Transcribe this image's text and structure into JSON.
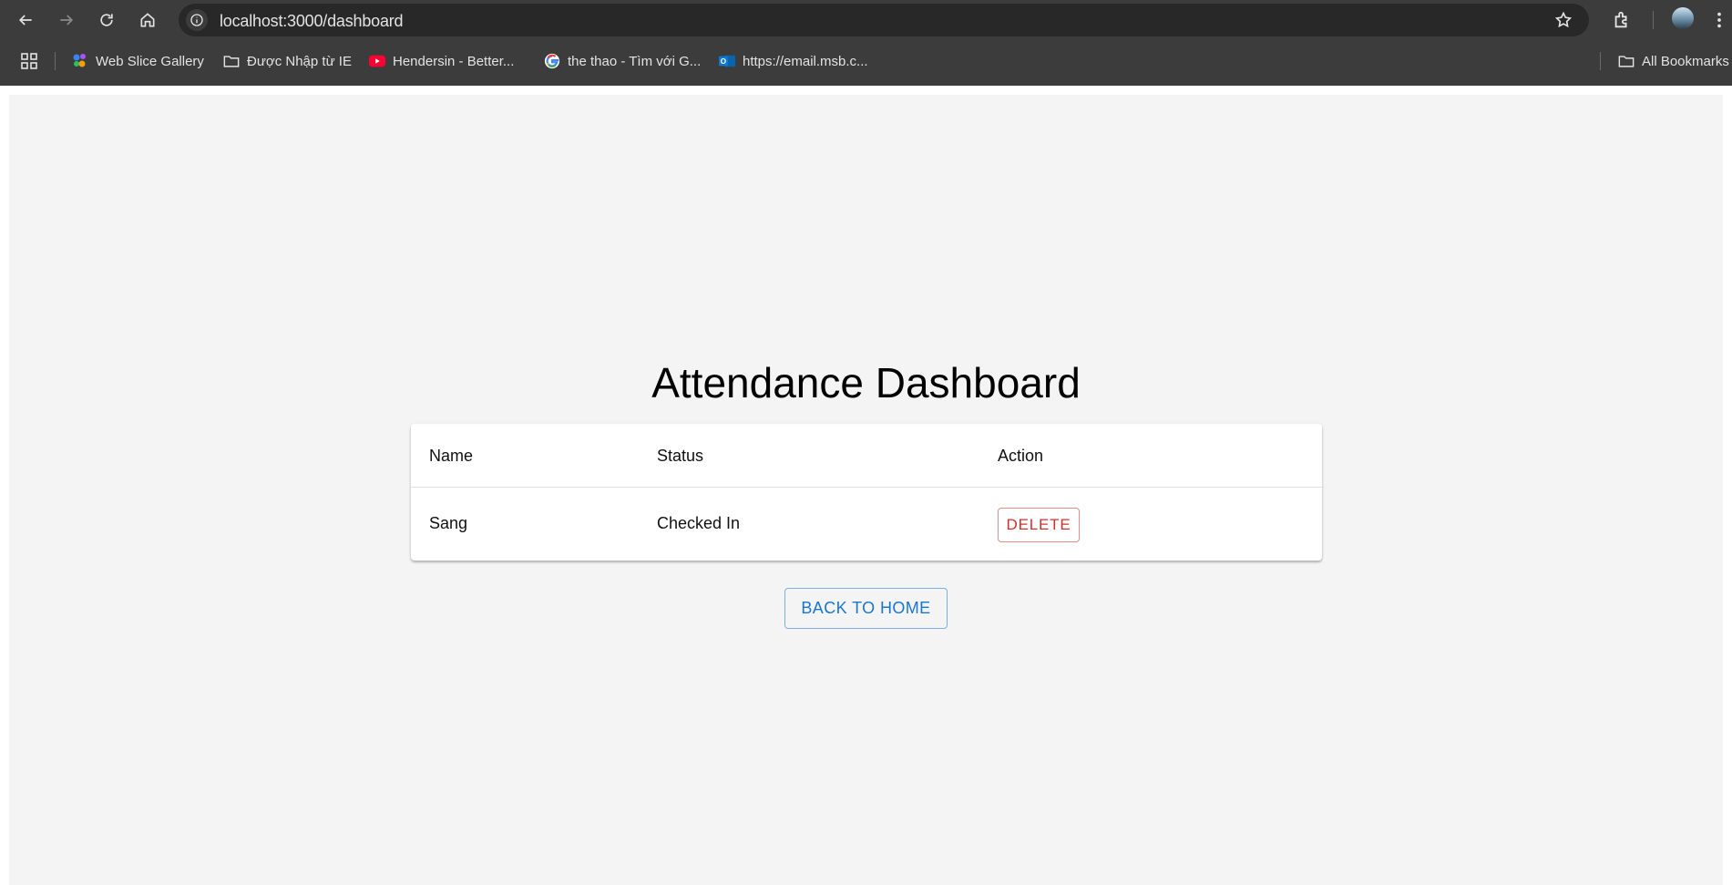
{
  "browser": {
    "url": "localhost:3000/dashboard",
    "bookmarks": [
      {
        "label": "Web Slice Gallery",
        "icon": "web-slice-icon"
      },
      {
        "label": "Được Nhập từ IE",
        "icon": "folder-icon"
      },
      {
        "label": "Hendersin - Better...",
        "icon": "youtube-icon"
      },
      {
        "label": "the thao - Tìm với G...",
        "icon": "google-icon"
      },
      {
        "label": "https://email.msb.c...",
        "icon": "outlook-icon"
      }
    ],
    "all_bookmarks_label": "All Bookmarks"
  },
  "page": {
    "title": "Attendance Dashboard",
    "table": {
      "headers": [
        "Name",
        "Status",
        "Action"
      ],
      "rows": [
        {
          "name": "Sang",
          "status": "Checked In",
          "action_label": "DELETE"
        }
      ]
    },
    "back_button_label": "BACK TO HOME"
  },
  "colors": {
    "delete": "#d32f2f",
    "primary": "#1976d2",
    "page_bg": "#f4f4f4",
    "chrome_bg": "#3c3c3c"
  }
}
